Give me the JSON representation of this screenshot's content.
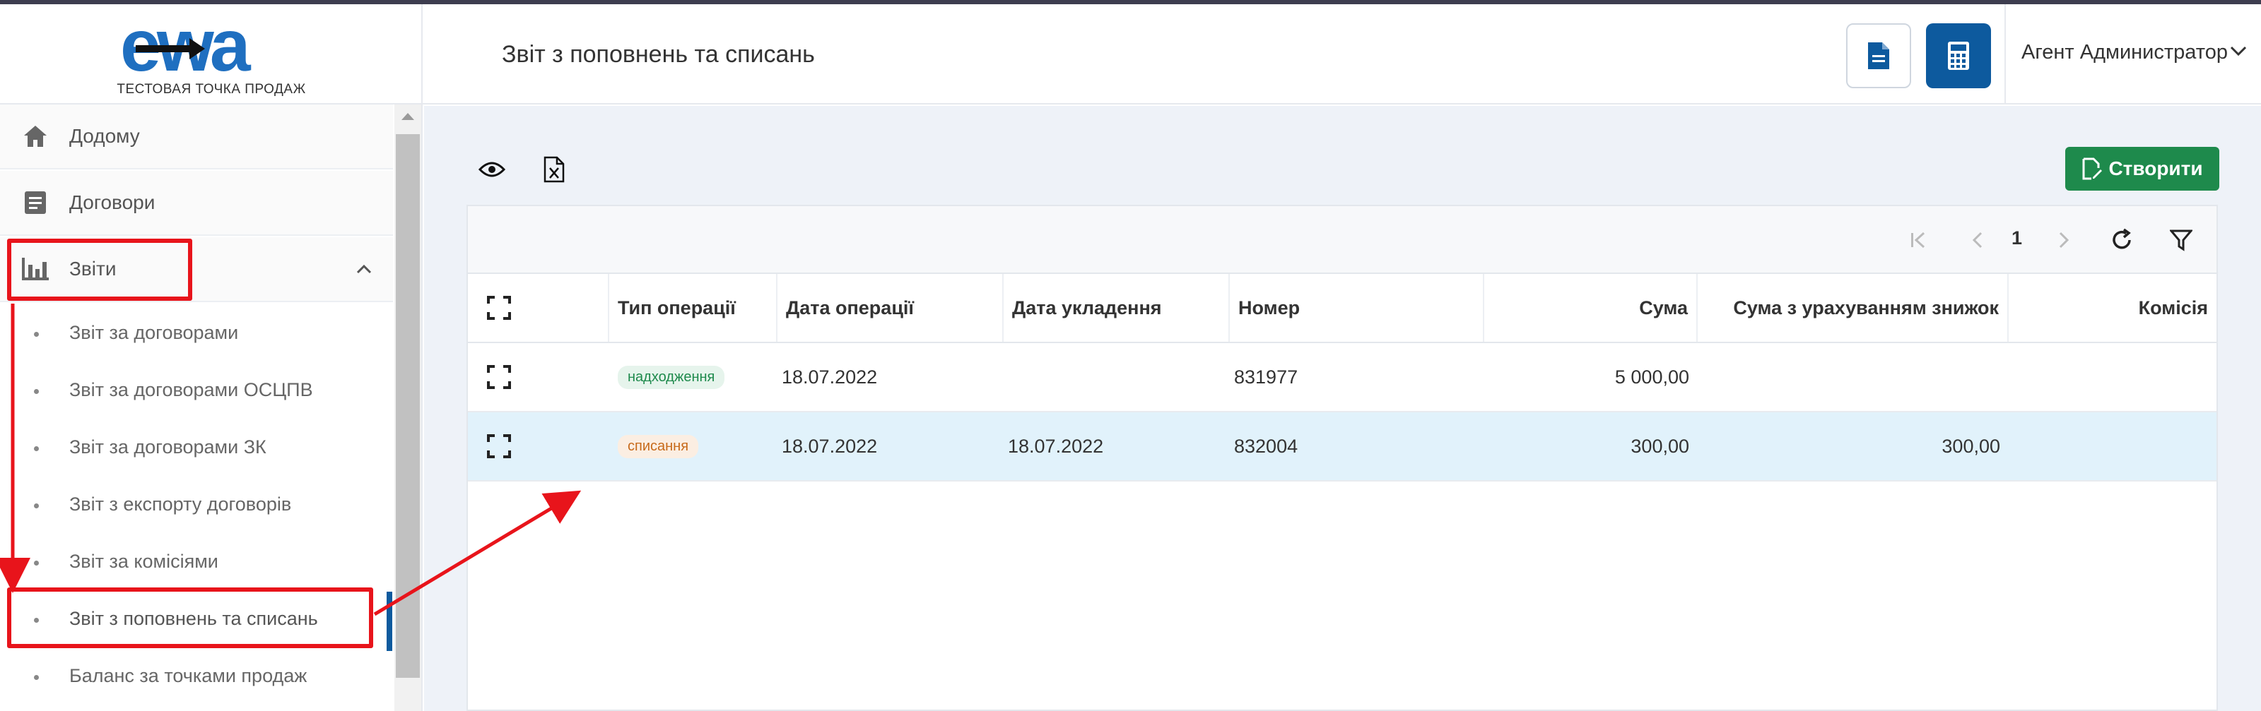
{
  "header": {
    "logo_text": "ewa",
    "logo_subtitle": "ТЕСТОВАЯ ТОЧКА ПРОДАЖ",
    "page_title": "Звіт з поповнень та списань",
    "user_name": "Агент Администратор"
  },
  "sidebar": {
    "items": [
      {
        "label": "Додому",
        "icon": "home-icon"
      },
      {
        "label": "Договори",
        "icon": "document-icon"
      },
      {
        "label": "Звіти",
        "icon": "bar-chart-icon"
      }
    ],
    "reports_sub": [
      {
        "label": "Звіт за договорами"
      },
      {
        "label": "Звіт за договорами ОСЦПВ"
      },
      {
        "label": "Звіт за договорами ЗК"
      },
      {
        "label": "Звіт з експорту договорів"
      },
      {
        "label": "Звіт за комісіями"
      },
      {
        "label": "Звіт з поповнень та списань"
      },
      {
        "label": "Баланс за точками продаж"
      }
    ]
  },
  "toolbar": {
    "create_label": "Створити"
  },
  "pager": {
    "page": "1"
  },
  "table": {
    "columns": [
      "Тип операції",
      "Дата операції",
      "Дата укладення",
      "Номер",
      "Сума",
      "Сума з урахуванням знижок",
      "Комісія"
    ],
    "rows": [
      {
        "type": "надходження",
        "op_date": "18.07.2022",
        "contract_date": "",
        "number": "831977",
        "sum": "5 000,00",
        "sum_discount": "",
        "commission": ""
      },
      {
        "type": "списання",
        "op_date": "18.07.2022",
        "contract_date": "18.07.2022",
        "number": "832004",
        "sum": "300,00",
        "sum_discount": "300,00",
        "commission": ""
      }
    ]
  },
  "colors": {
    "brand_blue": "#0d5a9e",
    "create_green": "#1e8a4c",
    "annotation_red": "#e8141b",
    "selected_row": "#e1f2fb"
  }
}
